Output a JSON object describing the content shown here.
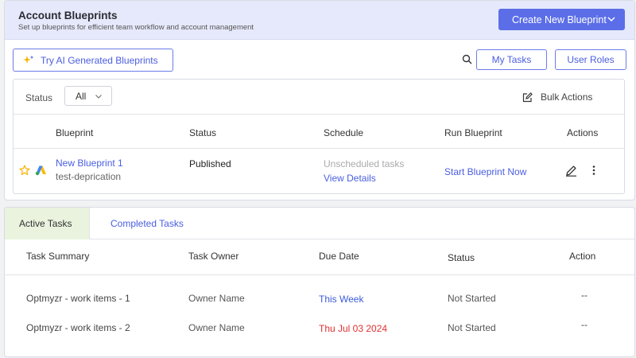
{
  "header": {
    "title": "Account Blueprints",
    "subtitle": "Set up blueprints for efficient team workflow and account management",
    "create_button": "Create New Blueprint"
  },
  "toolbar": {
    "ai_button": "Try AI Generated Blueprints",
    "my_tasks": "My Tasks",
    "user_roles": "User Roles"
  },
  "filters": {
    "status_label": "Status",
    "status_value": "All",
    "bulk_actions": "Bulk Actions"
  },
  "blueprint_table": {
    "columns": [
      "Blueprint",
      "Status",
      "Schedule",
      "Run Blueprint",
      "Actions"
    ],
    "rows": [
      {
        "name": "New Blueprint 1",
        "sub": "test-deprication",
        "status": "Published",
        "schedule": "Unscheduled tasks",
        "schedule_link": "View Details",
        "run": "Start Blueprint Now"
      }
    ]
  },
  "tasks": {
    "tabs": [
      "Active Tasks",
      "Completed Tasks"
    ],
    "active_tab": "Active Tasks",
    "columns": [
      "Task Summary",
      "Task Owner",
      "Due Date",
      "Status",
      "Action"
    ],
    "rows": [
      {
        "summary": "Optmyzr - work items - 1",
        "owner": "Owner Name",
        "due": "This Week",
        "due_color": "#3b5bdb",
        "status": "Not Started",
        "action": "--"
      },
      {
        "summary": "Optmyzr - work items - 2",
        "owner": "Owner Name",
        "due": "Thu Jul 03 2024",
        "due_color": "#e03131",
        "status": "Not Started",
        "action": "--"
      }
    ]
  },
  "colors": {
    "primary": "#5b6ee8",
    "link": "#4a5ee0",
    "header_bg": "#e6e9fb",
    "active_tab_bg": "#e9f3de",
    "star": "#f5b400"
  },
  "icons": [
    "chevron-down-icon",
    "sparkle-icon",
    "search-icon",
    "edit-icon",
    "star-icon",
    "google-ads-icon",
    "pen-icon",
    "kebab-icon"
  ]
}
